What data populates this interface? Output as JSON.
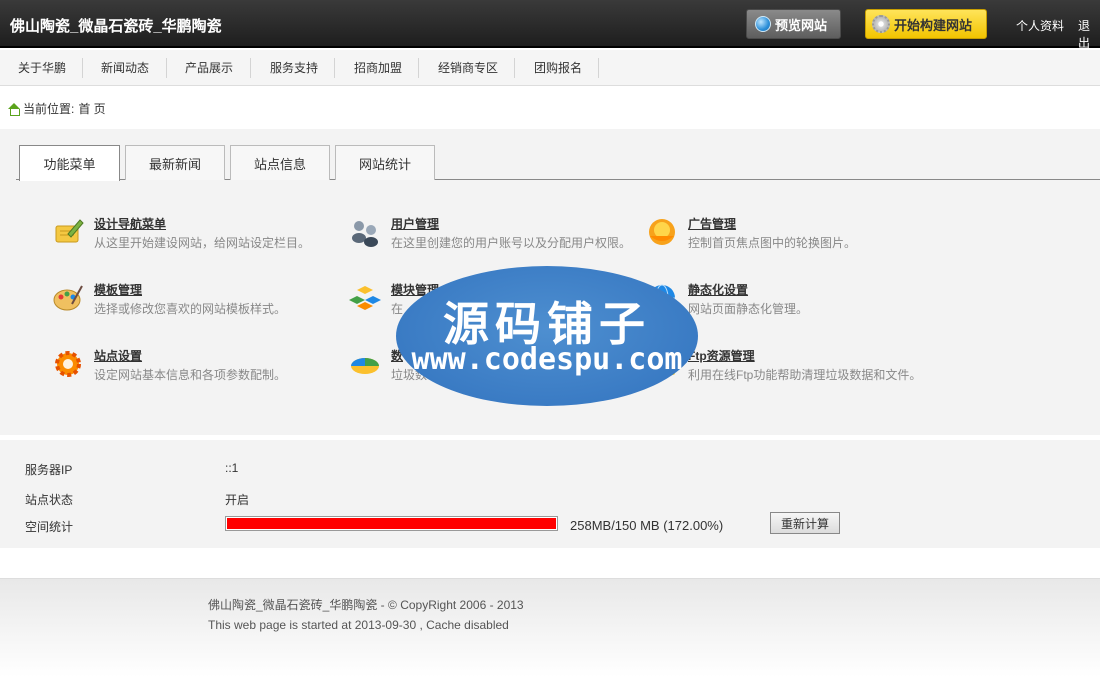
{
  "header": {
    "site_title": "佛山陶瓷_微晶石瓷砖_华鹏陶瓷",
    "preview_button": "预览网站",
    "build_button": "开始构建网站",
    "profile_link": "个人资料",
    "logout_link": "退出"
  },
  "nav": {
    "items": [
      "关于华鹏",
      "新闻动态",
      "产品展示",
      "服务支持",
      "招商加盟",
      "经销商专区",
      "团购报名"
    ]
  },
  "breadcrumb": {
    "label": "当前位置:",
    "current": "首 页"
  },
  "tabs": [
    "功能菜单",
    "最新新闻",
    "站点信息",
    "网站统计"
  ],
  "functions": [
    {
      "title": "设计导航菜单",
      "desc": "从这里开始建设网站，给网站设定栏目。",
      "icon": "pencil-notebook-icon"
    },
    {
      "title": "用户管理",
      "desc": "在这里创建您的用户账号以及分配用户权限。",
      "icon": "users-icon"
    },
    {
      "title": "广告管理",
      "desc": "控制首页焦点图中的轮换图片。",
      "icon": "sun-icon"
    },
    {
      "title": "模板管理",
      "desc": "选择或修改您喜欢的网站模板样式。",
      "icon": "palette-icon"
    },
    {
      "title": "模块管理",
      "desc": "在",
      "icon": "cubes-icon"
    },
    {
      "title": "静态化设置",
      "desc": "网站页面静态化管理。",
      "icon": "globe-icon"
    },
    {
      "title": "站点设置",
      "desc": "设定网站基本信息和各项参数配制。",
      "icon": "gear-icon"
    },
    {
      "title": "数",
      "desc": "垃圾数",
      "icon": "pie-chart-icon"
    },
    {
      "title": "Ftp资源管理",
      "desc": "利用在线Ftp功能帮助清理垃圾数据和文件。",
      "icon": "folder-icon"
    }
  ],
  "watermark": {
    "cn": "源码铺子",
    "en": "www.codespu.com"
  },
  "info": {
    "server_ip_label": "服务器IP",
    "server_ip_value": "::1",
    "status_label": "站点状态",
    "status_value": "开启",
    "space_label": "空间统计",
    "space_value": "258MB/150 MB (172.00%)",
    "space_percent": 172,
    "recalc_button": "重新计算"
  },
  "footer": {
    "copyright": "佛山陶瓷_微晶石瓷砖_华鹏陶瓷 - © CopyRight 2006 - 2013",
    "started": "This web page is started at 2013-09-30 , Cache disabled"
  }
}
